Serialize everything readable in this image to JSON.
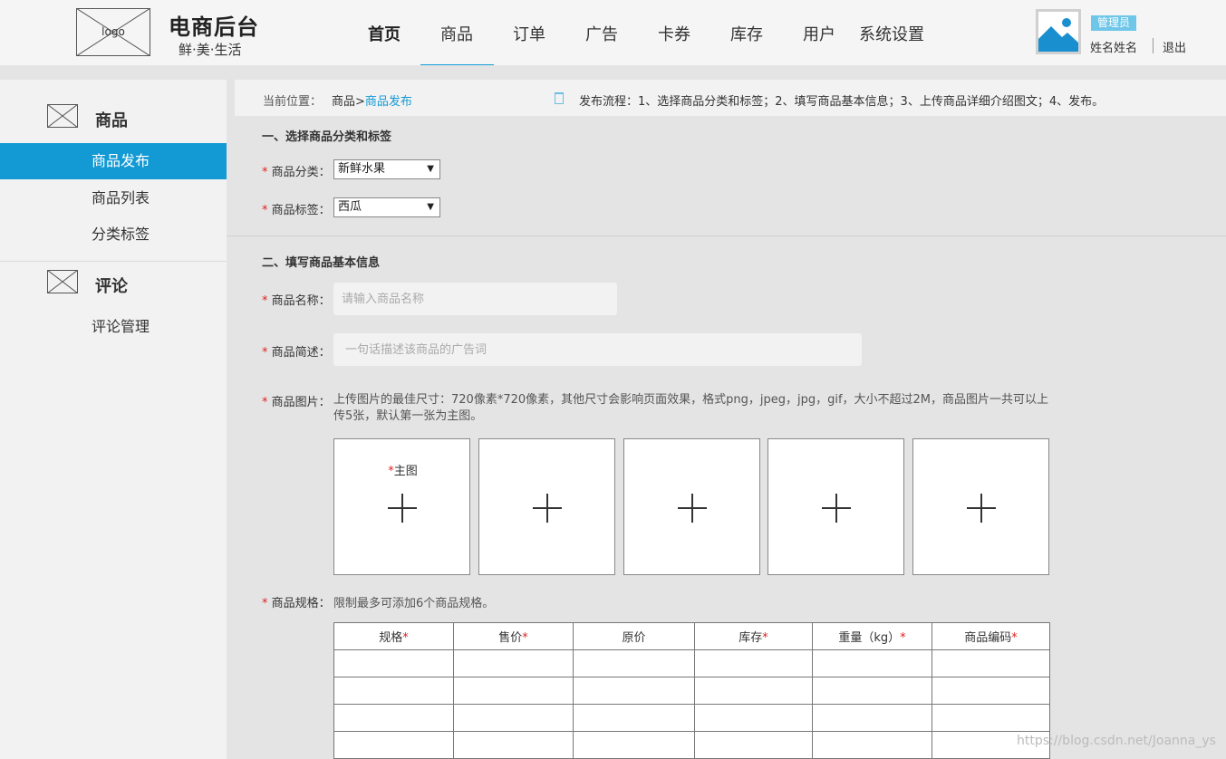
{
  "header": {
    "logo_text": "logo",
    "brand_title": "电商后台",
    "brand_subtitle": "鲜·美·生活",
    "nav": [
      "首页",
      "商品",
      "订单",
      "广告",
      "卡券",
      "库存",
      "用户",
      "系统设置"
    ],
    "active_nav": "商品",
    "role_badge": "管理员",
    "user_name": "姓名姓名",
    "logout": "退出"
  },
  "sidebar": {
    "groups": [
      {
        "title": "商品",
        "items": [
          "商品发布",
          "商品列表",
          "分类标签"
        ],
        "active": "商品发布"
      },
      {
        "title": "评论",
        "items": [
          "评论管理"
        ]
      }
    ]
  },
  "breadcrumb": {
    "label": "当前位置：",
    "parent": "商品>",
    "current": "商品发布",
    "flow": "发布流程：1、选择商品分类和标签；2、填写商品基本信息；3、上传商品详细介绍图文；4、发布。"
  },
  "section1": {
    "title": "一、选择商品分类和标签",
    "category_label": "商品分类：",
    "category_value": "新鲜水果",
    "tag_label": "商品标签：",
    "tag_value": "西瓜"
  },
  "section2": {
    "title": "二、填写商品基本信息",
    "name_label": "商品名称：",
    "name_placeholder": "请输入商品名称",
    "desc_label": "商品简述：",
    "desc_placeholder": "一句话描述该商品的广告词",
    "image_label": "商品图片：",
    "image_hint": "上传图片的最佳尺寸：720像素*720像素，其他尺寸会影响页面效果，格式png，jpeg，jpg，gif，大小不超过2M，商品图片一共可以上传5张，默认第一张为主图。",
    "main_image_tag": "主图",
    "spec_label": "商品规格：",
    "spec_hint": "限制最多可添加6个商品规格。",
    "spec_columns": [
      {
        "name": "规格",
        "required": true
      },
      {
        "name": "售价",
        "required": true
      },
      {
        "name": "原价",
        "required": false
      },
      {
        "name": "库存",
        "required": true
      },
      {
        "name": "重量（kg）",
        "required": true
      },
      {
        "name": "商品编码",
        "required": true
      }
    ]
  },
  "watermark": "https://blog.csdn.net/Joanna_ys"
}
